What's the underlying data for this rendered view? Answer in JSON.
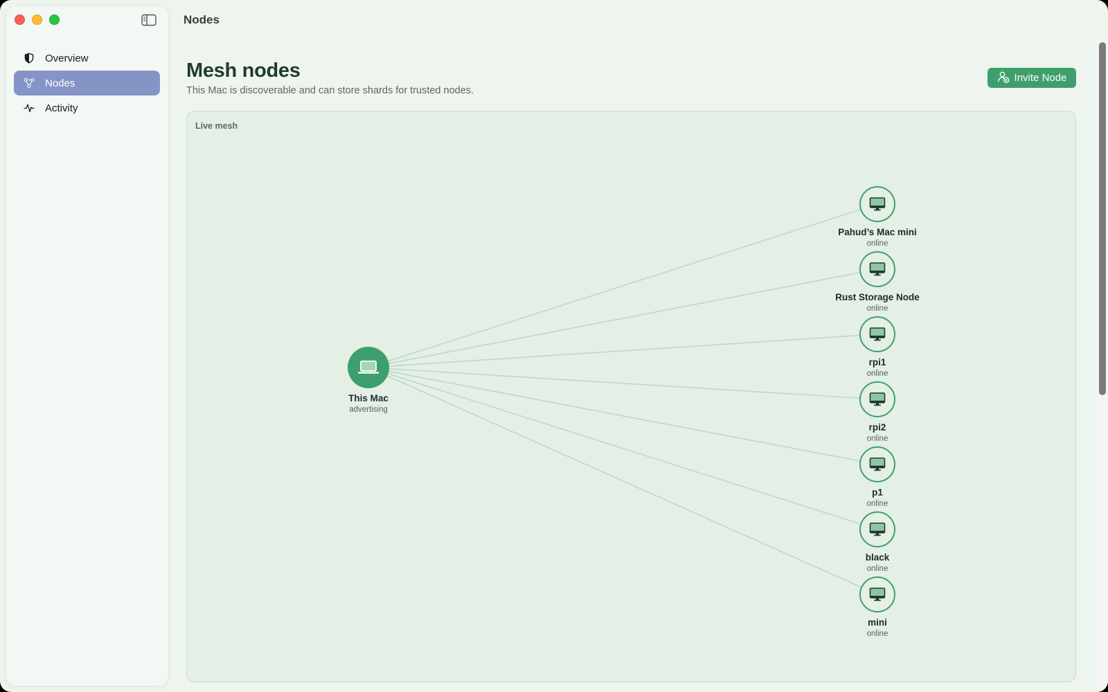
{
  "sidebar": {
    "items": [
      {
        "label": "Overview",
        "icon": "shield-half-icon",
        "active": false
      },
      {
        "label": "Nodes",
        "icon": "graph-nodes-icon",
        "active": true
      },
      {
        "label": "Activity",
        "icon": "waveform-icon",
        "active": false
      }
    ]
  },
  "toolbar": {
    "title": "Nodes"
  },
  "page": {
    "title": "Mesh nodes",
    "subtitle": "This Mac is discoverable and can store shards for trusted nodes.",
    "invite_label": "Invite Node"
  },
  "mesh": {
    "label": "Live mesh",
    "center": {
      "name": "This Mac",
      "status": "advertising",
      "icon": "laptop-icon"
    },
    "nodes": [
      {
        "name": "Pahud’s Mac mini",
        "status": "online",
        "icon": "desktop-icon"
      },
      {
        "name": "Rust Storage Node",
        "status": "online",
        "icon": "desktop-icon"
      },
      {
        "name": "rpi1",
        "status": "online",
        "icon": "desktop-icon"
      },
      {
        "name": "rpi2",
        "status": "online",
        "icon": "desktop-icon"
      },
      {
        "name": "p1",
        "status": "online",
        "icon": "desktop-icon"
      },
      {
        "name": "black",
        "status": "online",
        "icon": "desktop-icon"
      },
      {
        "name": "mini",
        "status": "online",
        "icon": "desktop-icon"
      }
    ]
  },
  "colors": {
    "accent": "#3e9f6d",
    "sidebar_active": "#8594c6",
    "link_line": "#bfd8c8"
  }
}
